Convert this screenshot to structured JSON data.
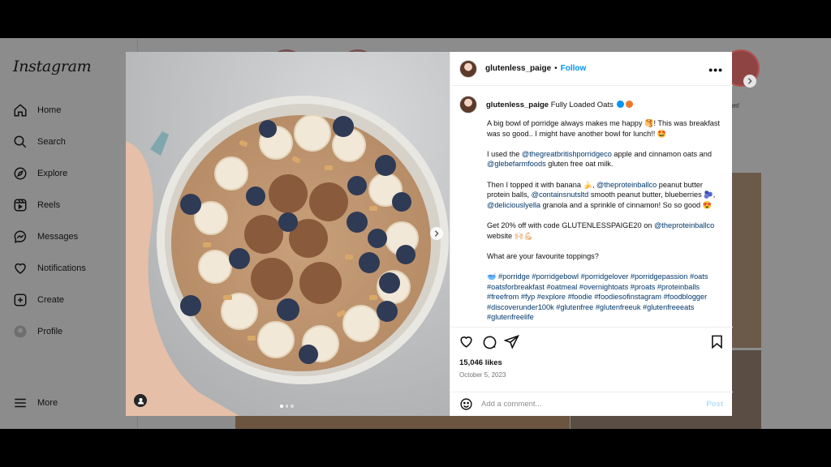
{
  "app": {
    "logo": "Instagram"
  },
  "sidebar": {
    "items": [
      {
        "label": "Home",
        "icon": "home-icon"
      },
      {
        "label": "Search",
        "icon": "search-icon"
      },
      {
        "label": "Explore",
        "icon": "compass-icon"
      },
      {
        "label": "Reels",
        "icon": "reels-icon"
      },
      {
        "label": "Messages",
        "icon": "messenger-icon"
      },
      {
        "label": "Notifications",
        "icon": "heart-icon"
      },
      {
        "label": "Create",
        "icon": "plus-square-icon"
      },
      {
        "label": "Profile",
        "icon": "avatar-icon"
      }
    ],
    "more_label": "More"
  },
  "background": {
    "story_caption_fragment": "en!"
  },
  "post": {
    "username": "glutenless_paige",
    "separator": "•",
    "follow_label": "Follow",
    "more_label": "•••",
    "caption": {
      "username": "glutenless_paige",
      "title": "Fully Loaded Oats",
      "p1": "A big bowl of porridge always makes me happy 🥞! This was breakfast was so good.. I might have another bowl for lunch!! 🤩",
      "p2_before": "I used the ",
      "p2_tag1": "@thegreatbritishporridgeco",
      "p2_mid": " apple and cinnamon oats and ",
      "p2_tag2": "@glebefarmfoods",
      "p2_after": " gluten free oat milk.",
      "p3_a": "Then I topped it with banana 🍌, ",
      "p3_tag1": "@theproteinballco",
      "p3_b": " peanut butter protein balls, ",
      "p3_tag2": "@containsnutsltd",
      "p3_c": " smooth peanut butter, blueberries 🫐, ",
      "p3_tag3": "@deliciouslyella",
      "p3_d": " granola and a sprinkle of cinnamon! So so good 😍",
      "p4_a": "Get 20% off with code GLUTENLESSPAIGE20 on ",
      "p4_tag": "@theproteinballco",
      "p4_b": " website 🙌🏻💪🏻",
      "p5": "What are your favourite toppings?",
      "hashtags_prefix": "🥣 ",
      "hashtags": "#porridge #porridgebowl #porridgelover #porridgepassion #oats #oatsforbreakfast #oatmeal #overnightoats #proats #proteinballs #freefrom #fyp #explore #foodie #foodiesofinstagram #foodblogger #discoverunder100k #glutenfree #glutenfreeuk #glutenfreeeats #glutenfreelife"
    },
    "likes": "15,046 likes",
    "date": "October 5, 2023",
    "comment_placeholder": "Add a comment...",
    "post_label": "Post",
    "carousel": {
      "count": 3,
      "active": 0
    }
  },
  "colors": {
    "accent": "#0095f6",
    "tag": "#00376b",
    "backdrop": "#8c8c8c"
  }
}
